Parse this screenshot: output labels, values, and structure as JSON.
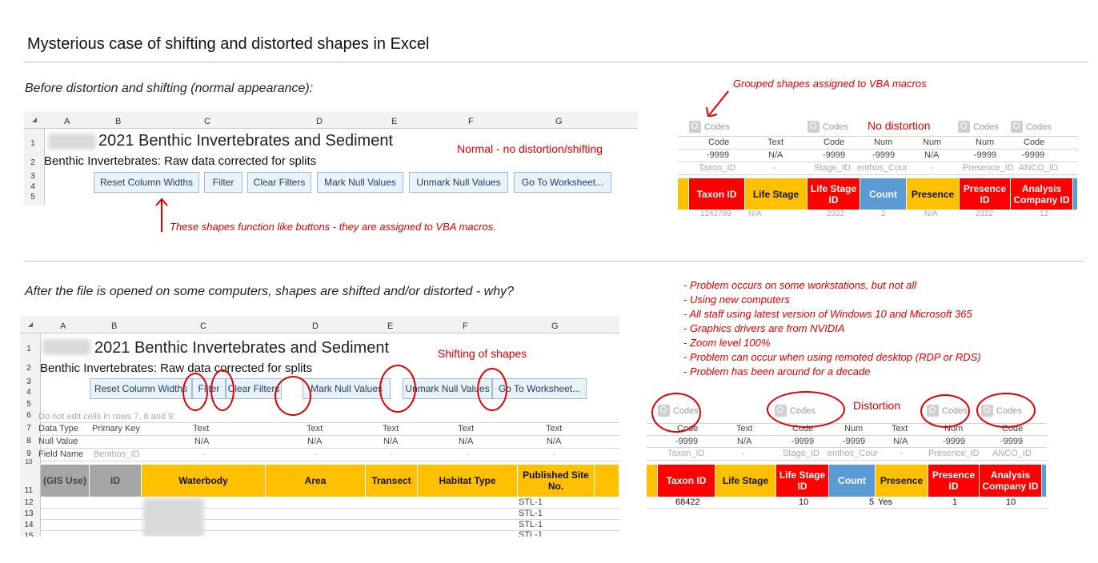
{
  "page": {
    "title": "Mysterious case of shifting and distorted shapes in Excel",
    "before_heading": "Before distortion and shifting (normal appearance):",
    "after_heading": "After the file is opened on some computers, shapes are shifted and/or distorted - why?"
  },
  "annotations": {
    "normal": "Normal - no distortion/shifting",
    "buttons_note": "These shapes function like buttons - they are assigned to VBA macros.",
    "grouped": "Grouped shapes assigned to VBA macros",
    "no_distortion": "No distortion",
    "shifting": "Shifting of shapes",
    "distortion": "Distortion"
  },
  "problem_list": [
    "- Problem occurs on some workstations, but not all",
    "- Using new computers",
    "- All staff using latest version of Windows 10 and Microsoft 365",
    "- Graphics drivers are from NVIDIA",
    "- Zoom level 100%",
    "- Problem can occur when using remoted desktop (RDP or RDS)",
    "- Problem has been around for a decade"
  ],
  "sheet": {
    "columns": [
      "A",
      "B",
      "C",
      "D",
      "E",
      "F",
      "G"
    ],
    "title": "2021 Benthic Invertebrates and Sediment",
    "subtitle": "Benthic Invertebrates: Raw data corrected for splits",
    "buttons": [
      "Reset Column Widths",
      "Filter",
      "Clear Filters",
      "Mark Null Values",
      "Unmark Null Values",
      "Go To Worksheet..."
    ],
    "rows_top": [
      "1",
      "2",
      "3",
      "4",
      "5"
    ],
    "rows_bottom": [
      "1",
      "2",
      "3",
      "4",
      "5",
      "6",
      "7",
      "8",
      "9",
      "10",
      "11",
      "12",
      "13",
      "14",
      "15"
    ],
    "note_row6": "Do not edit cells in rows 7, 8 and 9:",
    "row_labels": [
      "Data Type",
      "Null Value",
      "Field Name"
    ],
    "primary_key": "Primary Key",
    "field_b": "Benthos_ID",
    "text": "Text",
    "na": "N/A",
    "dash": "-",
    "headers": [
      "(GIS Use)",
      "ID",
      "Waterbody",
      "Area",
      "Transect",
      "Habitat Type",
      "Published Site No."
    ],
    "site_values": [
      "STL-1",
      "STL-1",
      "STL-1",
      "STL-1"
    ]
  },
  "right_table": {
    "code_label": "Codes",
    "type_row": [
      "Code",
      "Text",
      "Code",
      "Num",
      "Num",
      "Text",
      "Num",
      "Code"
    ],
    "null_row": [
      "-9999",
      "N/A",
      "-9999",
      "-9999",
      "-9999",
      "N/A",
      "-9999",
      "-9999"
    ],
    "field_row": [
      "Taxon_ID",
      "-",
      "Stage_ID",
      "enthos_Cour",
      "-",
      "-",
      "Presence_ID",
      "ANCO_ID"
    ],
    "headers": [
      "Taxon ID",
      "Life Stage",
      "Life Stage ID",
      "Count",
      "Presence",
      "Presence ID",
      "Analysis Company ID"
    ],
    "data_row": [
      "68422",
      "",
      "10",
      "5",
      "Yes",
      "1",
      "10"
    ],
    "top_partial": [
      "1242789",
      "N/A",
      "2322",
      "2",
      "N/A",
      "2322",
      "12"
    ]
  },
  "colors": {
    "yellow": "#ffc000",
    "red": "#ff0000",
    "blue": "#5b9bd5",
    "annotation": "#e00000"
  }
}
